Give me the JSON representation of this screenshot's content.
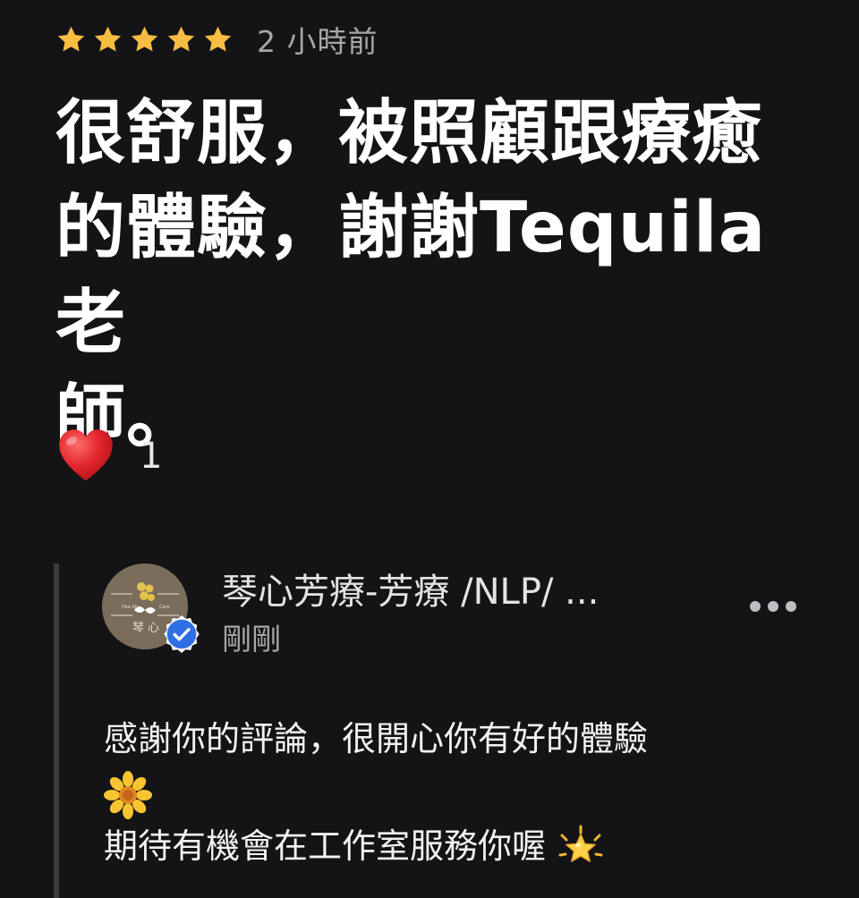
{
  "review": {
    "rating": 5,
    "rating_max": 5,
    "star_color": "#f7bd42",
    "timestamp": "2 小時前",
    "text": "很舒服，被照顧跟療癒\n的體驗，謝謝Tequila老\n師。",
    "reaction": {
      "icon": "heart-icon",
      "count": "1"
    }
  },
  "reply": {
    "author": "琴心芳療-芳療 /NLP/ ...",
    "verified": true,
    "verified_color": "#2f6fe4",
    "time": "剛剛",
    "avatar": {
      "icon": "qinxin-logo",
      "text": "琴 心",
      "left_label": "Hea lth",
      "right_label": "Care"
    },
    "more_icon": "more-horizontal-icon",
    "lines": [
      {
        "text": "感謝你的評論，很開心你有好的體驗",
        "emoji": ""
      },
      {
        "text": "",
        "emoji": "sunflower-icon"
      },
      {
        "text": "期待有機會在工作室服務你喔",
        "emoji": "glowing-star-icon"
      }
    ]
  }
}
